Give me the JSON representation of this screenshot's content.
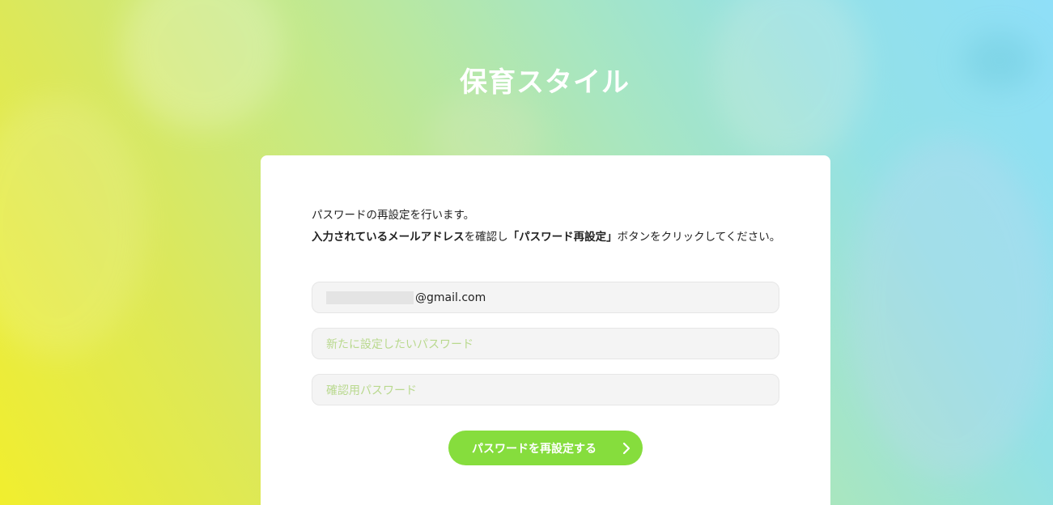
{
  "app": {
    "title": "保育スタイル"
  },
  "form": {
    "description_line1": "パスワードの再設定を行います。",
    "description_line2_bold1": "入力されているメールアドレス",
    "description_line2_normal1": "を確認し",
    "description_line2_bold2": "「パスワード再設定」",
    "description_line2_normal2": "ボタンをクリックしてください。",
    "email_value": "@gmail.com",
    "new_password_placeholder": "新たに設定したいパスワード",
    "confirm_password_placeholder": "確認用パスワード",
    "submit_label": "パスワードを再設定する",
    "submit_icon": "chevron-right-icon"
  },
  "colors": {
    "accent": "#86dd3d",
    "placeholder": "#b9d98e",
    "field_bg": "#f4f4f4"
  }
}
